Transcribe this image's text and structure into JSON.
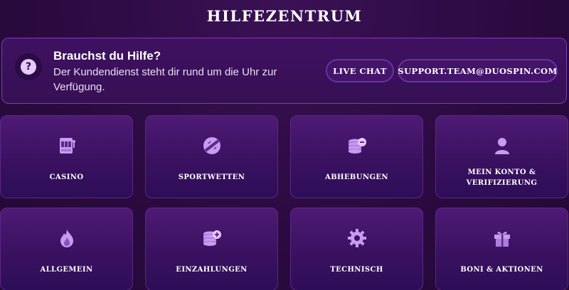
{
  "page": {
    "title": "HILFEZENTRUM"
  },
  "help": {
    "title": "Brauchst du Hilfe?",
    "text": "Der Kundendienst steht dir rund um die Uhr zur Verfügung.",
    "live_chat_label": "LIVE CHAT",
    "email_label": "SUPPORT.TEAM@DUOSPIN.COM"
  },
  "categories": [
    {
      "label": "CASINO",
      "icon": "slot-machine-icon"
    },
    {
      "label": "SPORTWETTEN",
      "icon": "sports-ball-icon"
    },
    {
      "label": "ABHEBUNGEN",
      "icon": "coins-minus-icon"
    },
    {
      "label": "MEIN KONTO & VERIFIZIERUNG",
      "icon": "user-icon"
    },
    {
      "label": "ALLGEMEIN",
      "icon": "fire-icon"
    },
    {
      "label": "EINZAHLUNGEN",
      "icon": "coins-plus-icon"
    },
    {
      "label": "TECHNISCH",
      "icon": "gear-icon"
    },
    {
      "label": "BONI & AKTIONEN",
      "icon": "gift-icon"
    }
  ],
  "colors": {
    "accent": "#b07be0",
    "icon": "#c89af0",
    "background": "#2a0a3f",
    "border": "#7d3bb8"
  }
}
